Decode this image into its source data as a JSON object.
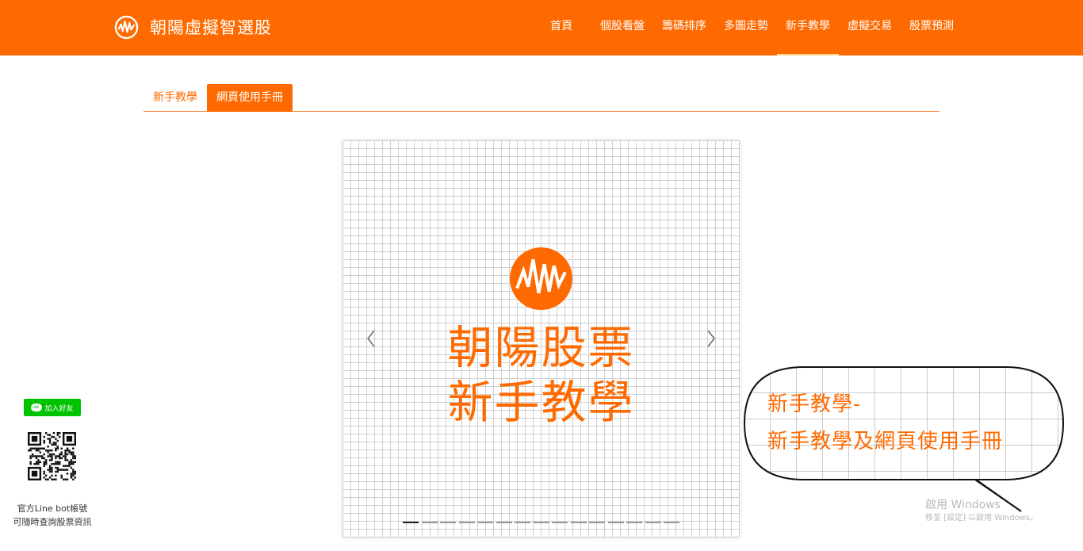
{
  "brand": {
    "name": "朝陽虛擬智選股",
    "logo": "pulse-logo-icon"
  },
  "nav": {
    "items": [
      {
        "label": "首頁"
      },
      {
        "label": "個股看盤"
      },
      {
        "label": "籌碼排序"
      },
      {
        "label": "多圖走勢"
      },
      {
        "label": "新手教學",
        "active": true
      },
      {
        "label": "虛擬交易"
      },
      {
        "label": "股票預測"
      }
    ]
  },
  "tabs": [
    {
      "label": "新手教學"
    },
    {
      "label": "網頁使用手冊",
      "active": true
    }
  ],
  "carousel": {
    "line1": "朝陽股票",
    "line2": "新手教學",
    "slide_count": 15,
    "active_index": 0
  },
  "bubble": {
    "line1": "新手教學-",
    "line2": "新手教學及網頁使用手冊"
  },
  "line_promo": {
    "button_label": "加入好友",
    "caption1": "官方Line bot帳號",
    "caption2": "可隨時查詢股票資訊"
  },
  "watermark": {
    "line1": "啟用 Windows",
    "line2": "移至 [設定] 以啟用 Windows。"
  },
  "colors": {
    "accent": "#ff6a00",
    "line_green": "#00c300"
  }
}
